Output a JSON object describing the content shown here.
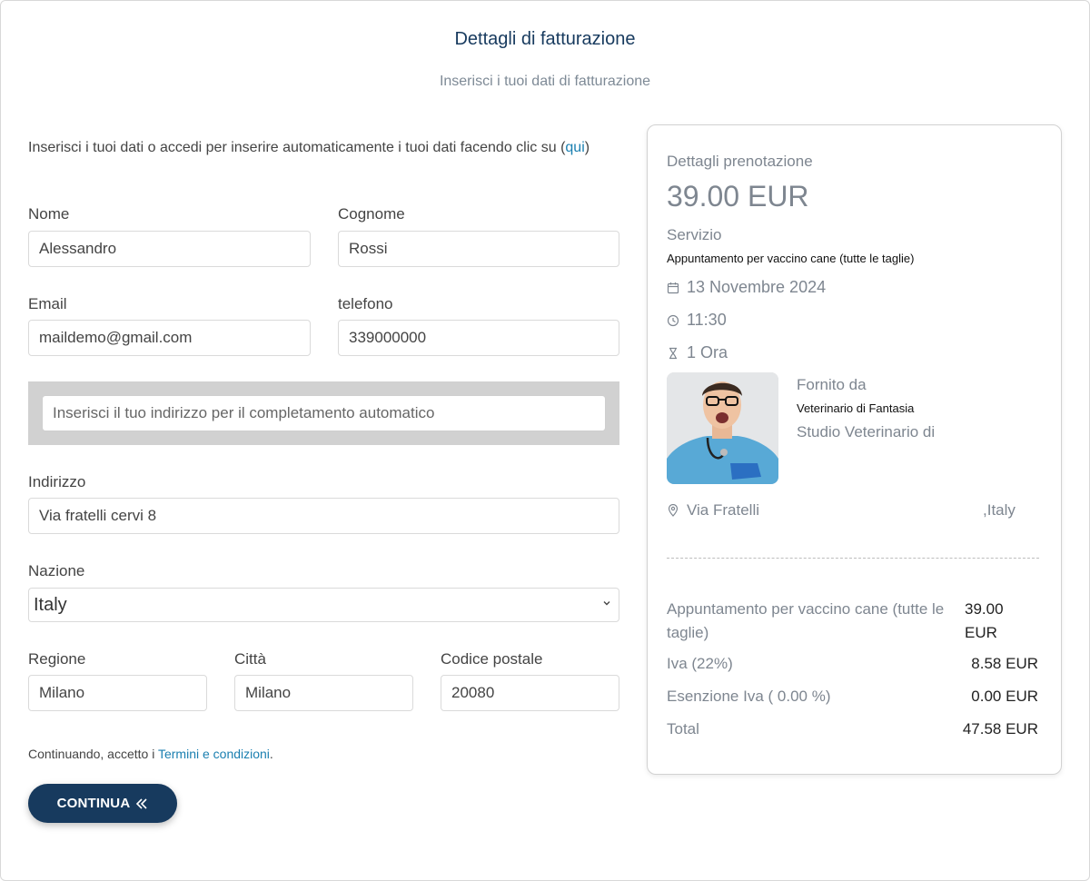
{
  "header": {
    "title": "Dettagli di fatturazione",
    "subtitle": "Inserisci i tuoi dati di fatturazione"
  },
  "intro": {
    "text": "Inserisci i tuoi dati o accedi per inserire automaticamente i tuoi dati facendo clic su",
    "link_open": "(",
    "link_label": "qui",
    "link_close": ")"
  },
  "form": {
    "first_name": {
      "label": "Nome",
      "value": "Alessandro"
    },
    "last_name": {
      "label": "Cognome",
      "value": "Rossi"
    },
    "email": {
      "label": "Email",
      "value": "maildemo@gmail.com"
    },
    "phone": {
      "label": "telefono",
      "value": "339000000"
    },
    "autocomplete_placeholder": "Inserisci il tuo indirizzo per il completamento automatico",
    "address": {
      "label": "Indirizzo",
      "value": "Via fratelli cervi 8"
    },
    "country": {
      "label": "Nazione",
      "value": "Italy"
    },
    "region": {
      "label": "Regione",
      "value": "Milano"
    },
    "city": {
      "label": "Città",
      "value": "Milano"
    },
    "postal_code": {
      "label": "Codice postale",
      "value": "20080"
    }
  },
  "terms": {
    "prefix": "Continuando, accetto i",
    "link_label": "Termini e condizioni",
    "suffix": "."
  },
  "continue_button": {
    "label": "CONTINUA"
  },
  "summary": {
    "heading": "Dettagli prenotazione",
    "price": "39.00 EUR",
    "service_label": "Servizio",
    "service_name": "Appuntamento per vaccino cane (tutte le taglie)",
    "date": "13 Novembre 2024",
    "time": "11:30",
    "duration": "1 Ora",
    "provider_label": "Fornito da",
    "provider_name": "Veterinario di Fantasia",
    "provider_org": "Studio Veterinario di",
    "location": "Via Fratelli",
    "country_suffix": ",Italy",
    "lines": [
      {
        "label": "Appuntamento per vaccino cane (tutte le taglie)",
        "amount": "39.00 EUR"
      },
      {
        "label": "Iva (22%)",
        "amount": "8.58 EUR"
      },
      {
        "label": "Esenzione Iva ( 0.00 %)",
        "amount": "0.00 EUR"
      },
      {
        "label": "Total",
        "amount": "47.58 EUR"
      }
    ]
  },
  "colors": {
    "primary": "#173a5e",
    "link": "#1a7fb0",
    "muted": "#7e8690"
  }
}
